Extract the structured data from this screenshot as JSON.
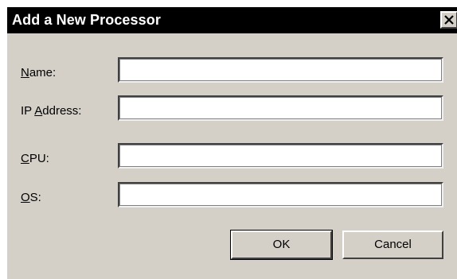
{
  "window": {
    "title": "Add a New Processor",
    "close_icon": "close-x-icon"
  },
  "form": {
    "fields": [
      {
        "label_mnemonic": "N",
        "label_rest": "ame:",
        "value": ""
      },
      {
        "label_prefix": "IP ",
        "label_mnemonic": "A",
        "label_rest": "ddress:",
        "value": ""
      },
      {
        "label_mnemonic": "C",
        "label_rest": "PU:",
        "value": ""
      },
      {
        "label_mnemonic": "O",
        "label_rest": "S:",
        "value": ""
      }
    ]
  },
  "buttons": {
    "ok_label": "OK",
    "cancel_label": "Cancel"
  },
  "colors": {
    "dialog_face": "#d4d0c8",
    "titlebar": "#000000",
    "title_text": "#ffffff",
    "input_background": "#ffffff"
  }
}
